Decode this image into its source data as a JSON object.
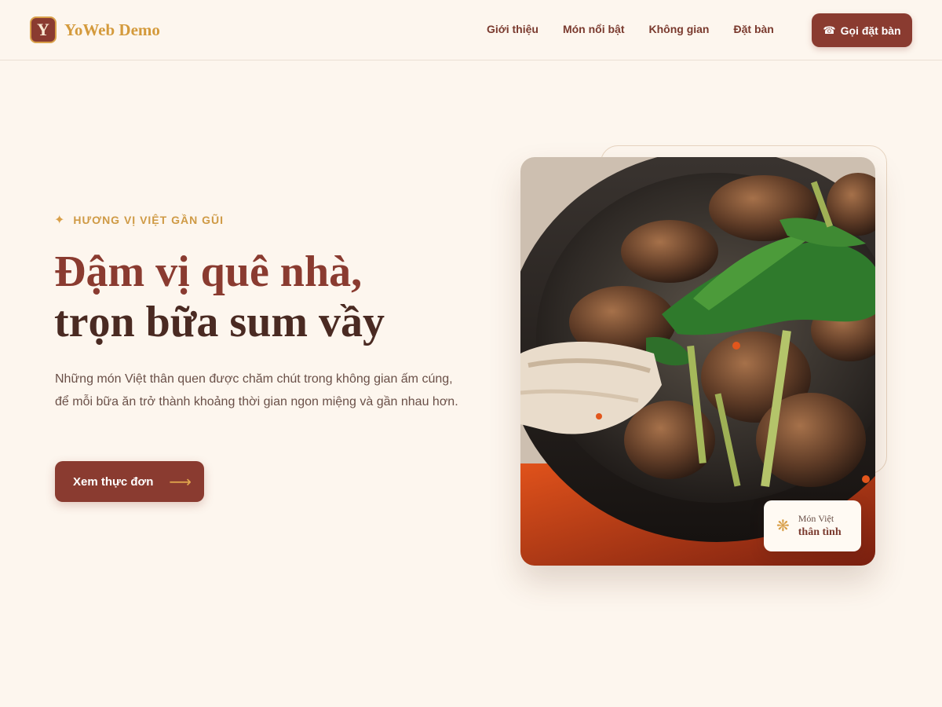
{
  "header": {
    "logo_letter": "Y",
    "brand": "YoWeb Demo",
    "nav": [
      {
        "label": "Giới thiệu"
      },
      {
        "label": "Món nổi bật"
      },
      {
        "label": "Không gian"
      },
      {
        "label": "Đặt bàn"
      }
    ],
    "cta": {
      "icon": "phone-icon",
      "label": "Gọi đặt bàn"
    }
  },
  "hero": {
    "eyebrow": "HƯƠNG VỊ VIỆT GẦN GŨI",
    "title_line1": "Đậm vị quê nhà,",
    "title_line2": "trọn bữa sum vầy",
    "description": "Những món Việt thân quen được chăm chút trong không gian ấm cúng, để mỗi bữa ăn trở thành khoảng thời gian ngon miệng và gần nhau hơn.",
    "button_label": "Xem thực đơn",
    "image_alt": "clay-pot-snail-dish",
    "badge": {
      "small": "Món Việt",
      "big": "thân tình"
    }
  },
  "colors": {
    "background": "#fdf6ee",
    "primary": "#8a3b30",
    "accent": "#d49a3c",
    "heading_dark": "#4a2a22"
  }
}
